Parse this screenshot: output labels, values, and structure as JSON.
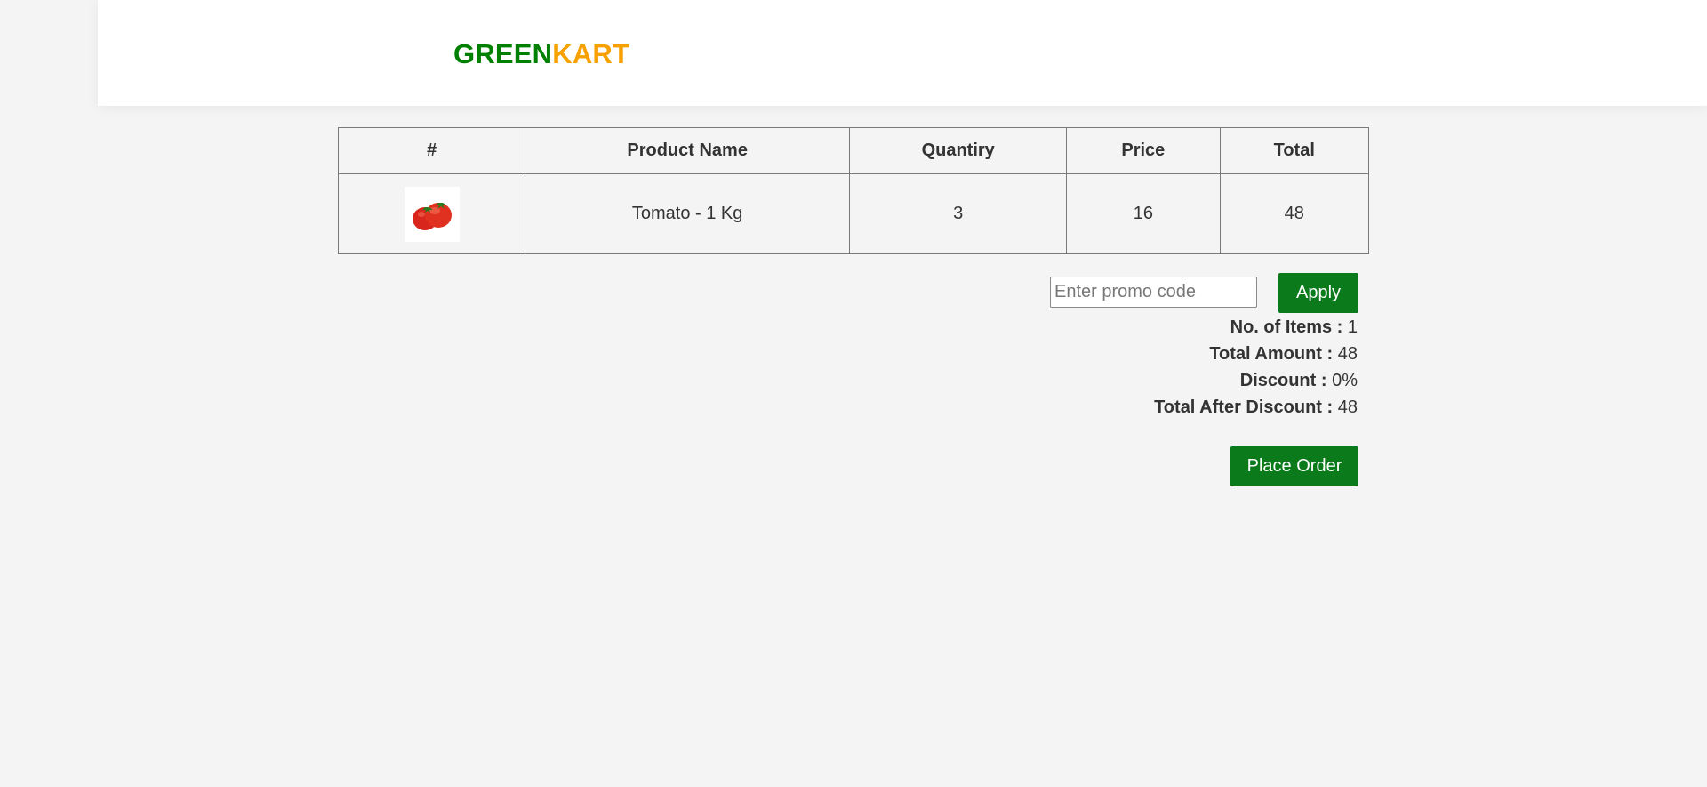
{
  "brand": {
    "part1": "GREEN",
    "part2": "KART",
    "color1": "#008000",
    "color2": "#f7a100"
  },
  "table": {
    "headers": [
      "#",
      "Product Name",
      "Quantiry",
      "Price",
      "Total"
    ],
    "rows": [
      {
        "image_icon": "tomato-icon",
        "name": "Tomato - 1 Kg",
        "quantity": "3",
        "price": "16",
        "total": "48"
      }
    ]
  },
  "promo": {
    "placeholder": "Enter promo code",
    "value": "",
    "apply_label": "Apply"
  },
  "summary": {
    "items_label": "No. of Items :",
    "items_value": "1",
    "amount_label": "Total Amount :",
    "amount_value": "48",
    "discount_label": "Discount :",
    "discount_value": "0%",
    "after_label": "Total After Discount :",
    "after_value": "48"
  },
  "order": {
    "place_label": "Place Order"
  },
  "colors": {
    "button": "#0a7a1a",
    "background": "#f4f4f4"
  }
}
